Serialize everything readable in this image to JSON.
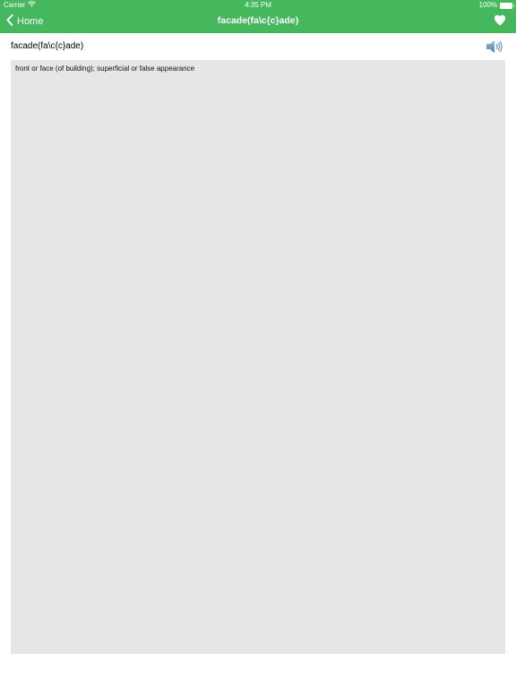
{
  "status_bar": {
    "carrier": "Carrier",
    "time": "4:35 PM",
    "battery": "100%"
  },
  "nav": {
    "back_label": "Home",
    "title": "facade(fa\\c{c}ade)",
    "back_icon": "chevron-left-icon",
    "favorite_icon": "heart-icon"
  },
  "entry": {
    "word": "facade(fa\\c{c}ade)",
    "speaker_icon": "speaker-icon",
    "definition": "front or face (of building); superficial or false appearance"
  },
  "colors": {
    "accent": "#45b75c",
    "definition_background": "#e6e6e6",
    "speaker": "#6a97b8"
  }
}
